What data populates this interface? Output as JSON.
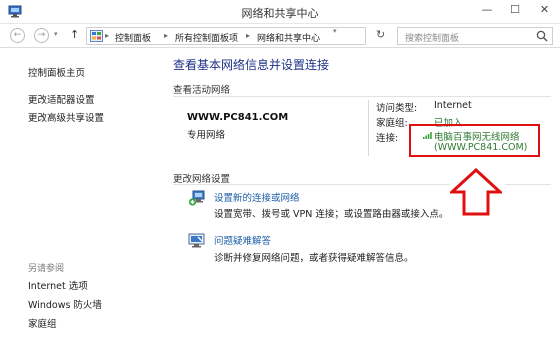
{
  "window": {
    "title": "网络和共享中心",
    "minimize_glyph": "—",
    "maximize_glyph": "☐",
    "close_glyph": "✕"
  },
  "nav": {
    "back_glyph": "←",
    "forward_glyph": "→",
    "dropdown_glyph": "▾",
    "up_glyph": "↑"
  },
  "address": {
    "separator": "▸",
    "crumbs": [
      "控制面板",
      "所有控制面板项",
      "网络和共享中心"
    ],
    "dropdown_glyph": "▾",
    "refresh_glyph": "↻"
  },
  "search": {
    "placeholder": "搜索控制面板",
    "icon": "search-icon"
  },
  "sidebar": {
    "links": [
      "控制面板主页",
      "更改适配器设置",
      "更改高级共享设置"
    ],
    "see_also_label": "另请参阅",
    "see_also_links": [
      "Internet 选项",
      "Windows 防火墙",
      "家庭组"
    ]
  },
  "main": {
    "title": "查看基本网络信息并设置连接",
    "active_networks_label": "查看活动网络",
    "network": {
      "name": "WWW.PC841.COM",
      "type": "专用网络",
      "access_type_label": "访问类型:",
      "access_type_value": "Internet",
      "homegroup_label": "家庭组:",
      "homegroup_value": "已加入",
      "connection_label": "连接:",
      "connection_line1": "电脑百事网无线网络",
      "connection_line2": "(WWW.PC841.COM)",
      "connection_icon": "wifi-signal-icon"
    },
    "change_settings_label": "更改网络设置",
    "tasks": [
      {
        "icon": "network-setup-icon",
        "link": "设置新的连接或网络",
        "desc": "设置宽带、拨号或 VPN 连接；或设置路由器或接入点。"
      },
      {
        "icon": "troubleshoot-icon",
        "link": "问题疑难解答",
        "desc": "诊断并修复网络问题，或者获得疑难解答信息。"
      }
    ]
  },
  "colors": {
    "link_blue": "#1e5ea8",
    "title_blue": "#1e3287",
    "connection_green": "#2e7a30",
    "annotation_red": "#e01010"
  }
}
